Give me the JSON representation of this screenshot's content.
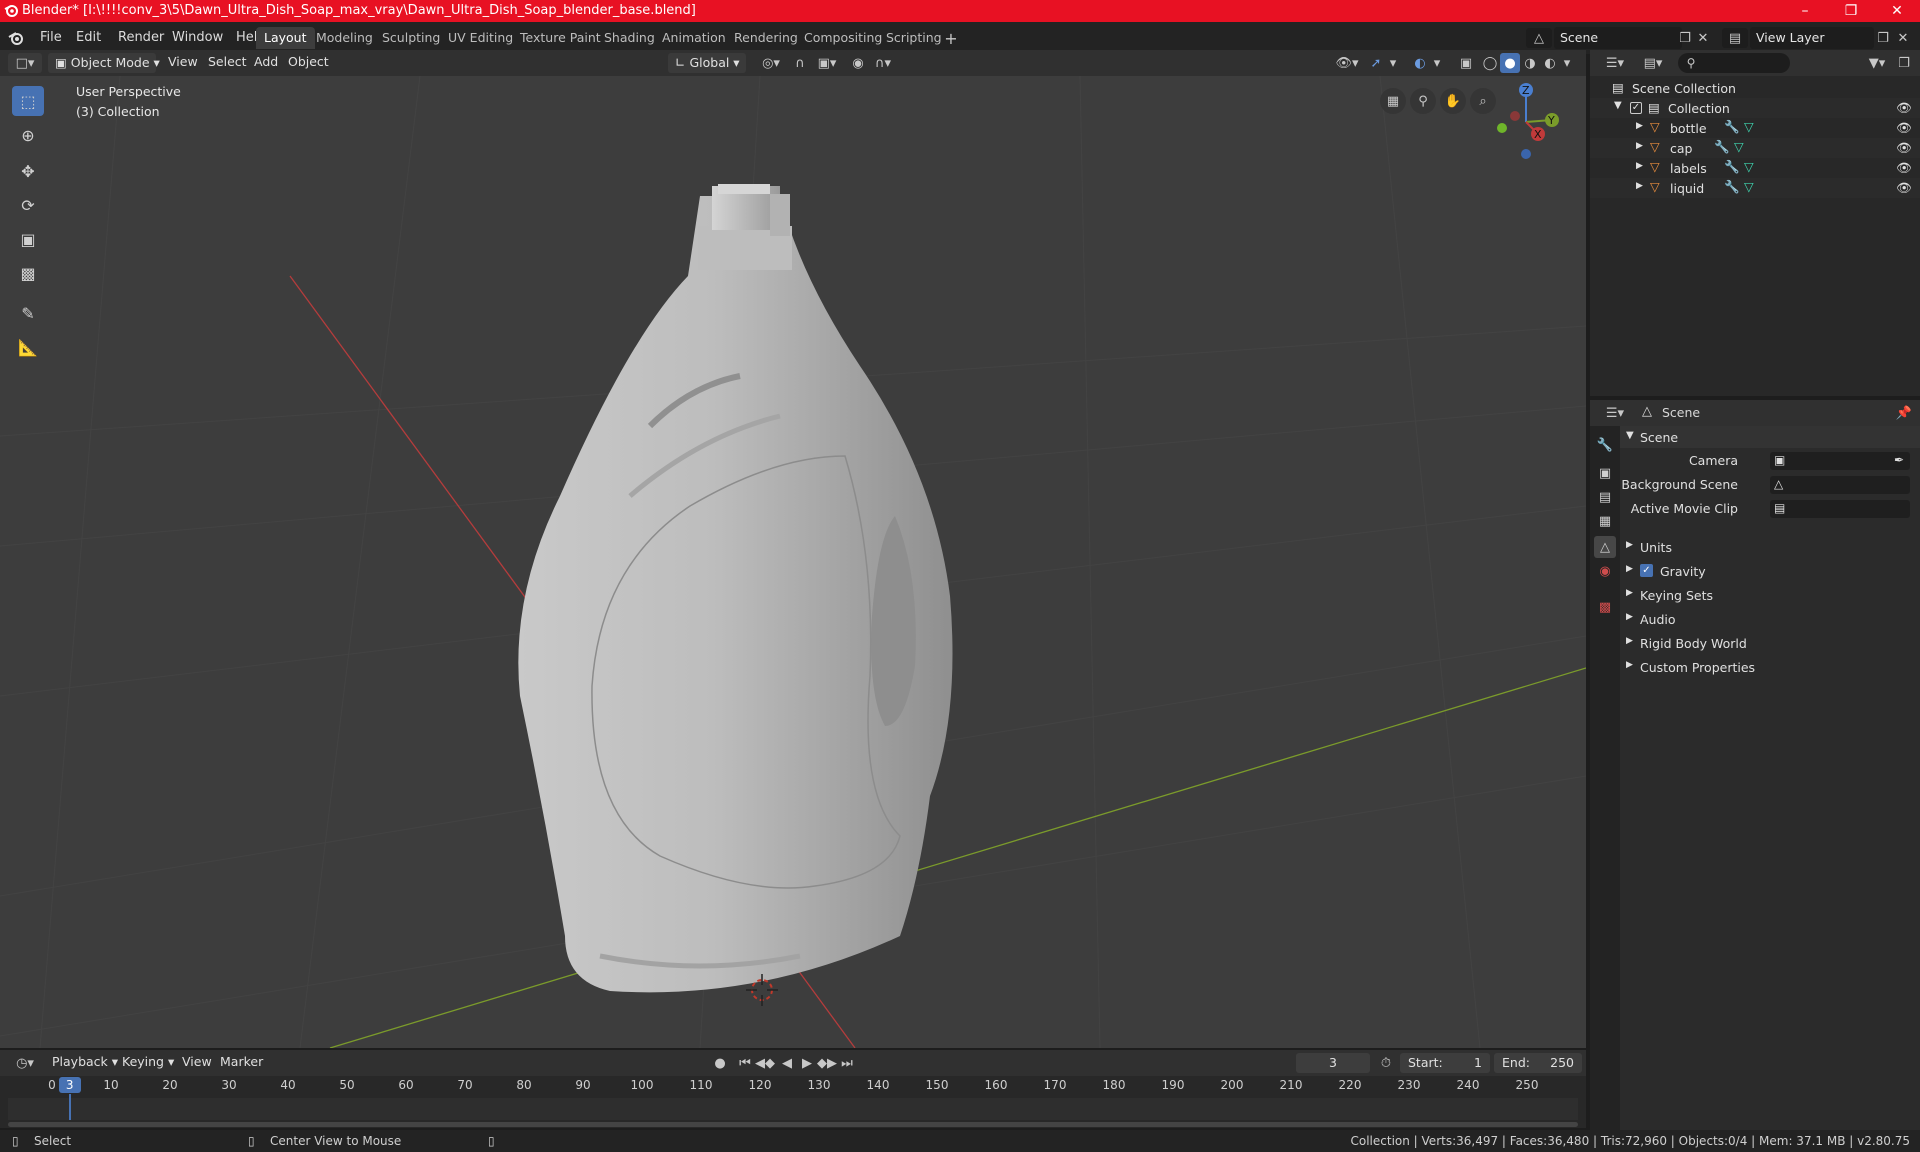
{
  "window": {
    "title": "Blender* [I:\\!!!!conv_3\\5\\Dawn_Ultra_Dish_Soap_max_vray\\Dawn_Ultra_Dish_Soap_blender_base.blend]",
    "minimize_icon": "minimize-icon",
    "maximize_icon": "maximize-icon",
    "close_icon": "close-icon"
  },
  "menu": [
    "File",
    "Edit",
    "Render",
    "Window",
    "Help"
  ],
  "workspaces": [
    "Layout",
    "Modeling",
    "Sculpting",
    "UV Editing",
    "Texture Paint",
    "Shading",
    "Animation",
    "Rendering",
    "Compositing",
    "Scripting"
  ],
  "active_workspace": "Layout",
  "scene_selector": {
    "value": "Scene"
  },
  "view_layer_selector": {
    "value": "View Layer"
  },
  "viewport_header": {
    "mode": "Object Mode",
    "menus": [
      "View",
      "Select",
      "Add",
      "Object"
    ],
    "transform_orientation": "Global"
  },
  "viewport": {
    "perspective_label": "User Perspective",
    "collection_label": "(3) Collection",
    "gizmo_axes": {
      "x": "X",
      "y": "Y",
      "z": "Z"
    },
    "colors": {
      "background": "#3d3d3d",
      "x_axis": "#c03a3a",
      "y_axis": "#7a9c2a",
      "accent": "#4772b3"
    }
  },
  "outliner": {
    "root": "Scene Collection",
    "collection": "Collection",
    "objects": [
      "bottle",
      "cap",
      "labels",
      "liquid"
    ]
  },
  "properties": {
    "header_title": "Scene",
    "panel_title": "Scene",
    "fields": [
      {
        "label": "Camera",
        "value": ""
      },
      {
        "label": "Background Scene",
        "value": ""
      },
      {
        "label": "Active Movie Clip",
        "value": ""
      }
    ],
    "sections": [
      "Units",
      "Gravity",
      "Keying Sets",
      "Audio",
      "Rigid Body World",
      "Custom Properties"
    ],
    "gravity_checked": true
  },
  "timeline": {
    "menus": [
      "Playback",
      "Keying",
      "View",
      "Marker"
    ],
    "current_frame": "3",
    "start_label": "Start:",
    "start": "1",
    "end_label": "End:",
    "end": "250",
    "ticks": [
      "0",
      "10",
      "20",
      "30",
      "40",
      "50",
      "60",
      "70",
      "80",
      "90",
      "100",
      "110",
      "120",
      "130",
      "140",
      "150",
      "160",
      "170",
      "180",
      "190",
      "200",
      "210",
      "220",
      "230",
      "240",
      "250"
    ],
    "playhead": "3"
  },
  "status_bar": {
    "left": "Select",
    "middle": "Center View to Mouse",
    "stats": "Collection | Verts:36,497 | Faces:36,480 | Tris:72,960 | Objects:0/4 | Mem: 37.1 MB | v2.80.75"
  }
}
